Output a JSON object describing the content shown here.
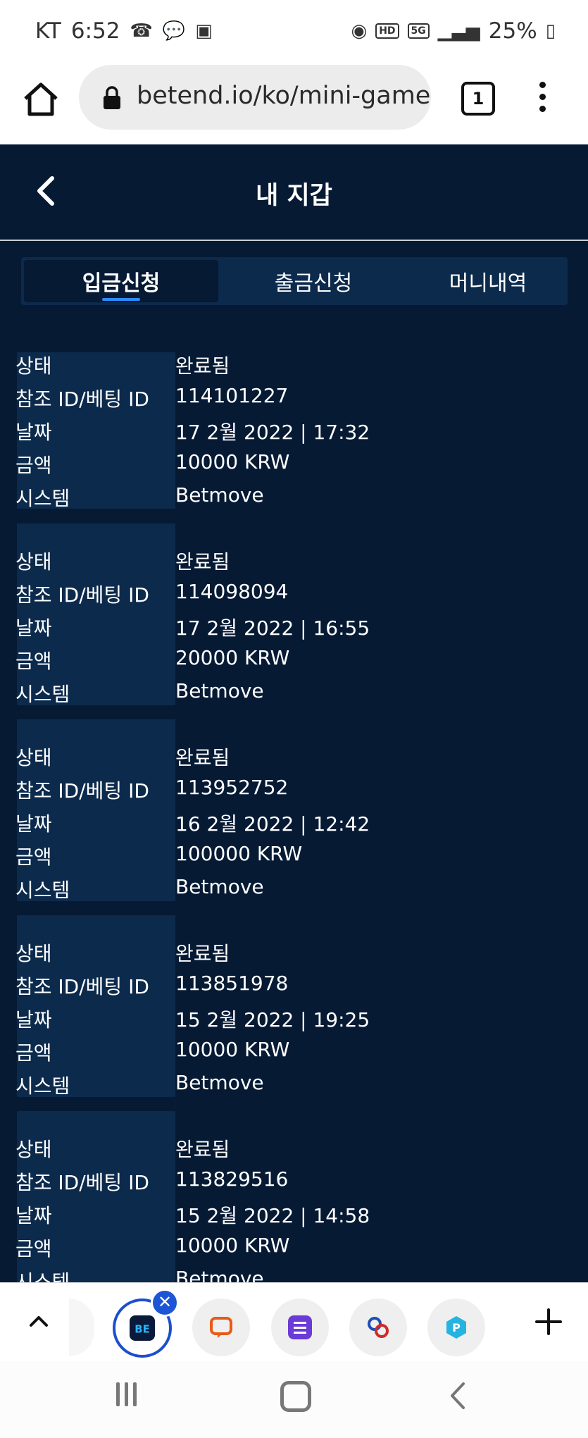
{
  "status_bar": {
    "carrier": "KT",
    "time": "6:52",
    "battery": "25%",
    "network": "5G",
    "hd_label": "HD"
  },
  "browser": {
    "url": "betend.io/ko/mini-game",
    "tab_count": "1"
  },
  "header": {
    "title": "내 지갑"
  },
  "tabs": [
    {
      "label": "입금신청",
      "active": true
    },
    {
      "label": "출금신청",
      "active": false
    },
    {
      "label": "머니내역",
      "active": false
    }
  ],
  "field_labels": {
    "status": "상태",
    "ref_id": "참조 ID/베팅 ID",
    "date": "날짜",
    "amount": "금액",
    "system": "시스템"
  },
  "transactions": [
    {
      "status": "완료됨",
      "ref_id": "114101227",
      "date": "17 2월 2022 | 17:32",
      "amount": "10000 KRW",
      "system": "Betmove"
    },
    {
      "status": "완료됨",
      "ref_id": "114098094",
      "date": "17 2월 2022 | 16:55",
      "amount": "20000 KRW",
      "system": "Betmove"
    },
    {
      "status": "완료됨",
      "ref_id": "113952752",
      "date": "16 2월 2022 | 12:42",
      "amount": "100000 KRW",
      "system": "Betmove"
    },
    {
      "status": "완료됨",
      "ref_id": "113851978",
      "date": "15 2월 2022 | 19:25",
      "amount": "10000 KRW",
      "system": "Betmove"
    },
    {
      "status": "완료됨",
      "ref_id": "113829516",
      "date": "15 2월 2022 | 14:58",
      "amount": "10000 KRW",
      "system": "Betmove"
    }
  ],
  "colors": {
    "page_bg": "#061a34",
    "card_bg": "#0c2a4c",
    "tab_indicator": "#2a8cff",
    "strip_active": "#1c4fcc"
  },
  "tab_strip": {
    "tabs": [
      {
        "icon": "betend-app-icon",
        "active": true
      },
      {
        "icon": "chat-app-icon",
        "active": false
      },
      {
        "icon": "list-app-icon",
        "active": false
      },
      {
        "icon": "logo-app-icon",
        "active": false
      },
      {
        "icon": "p-app-icon",
        "active": false
      }
    ]
  }
}
